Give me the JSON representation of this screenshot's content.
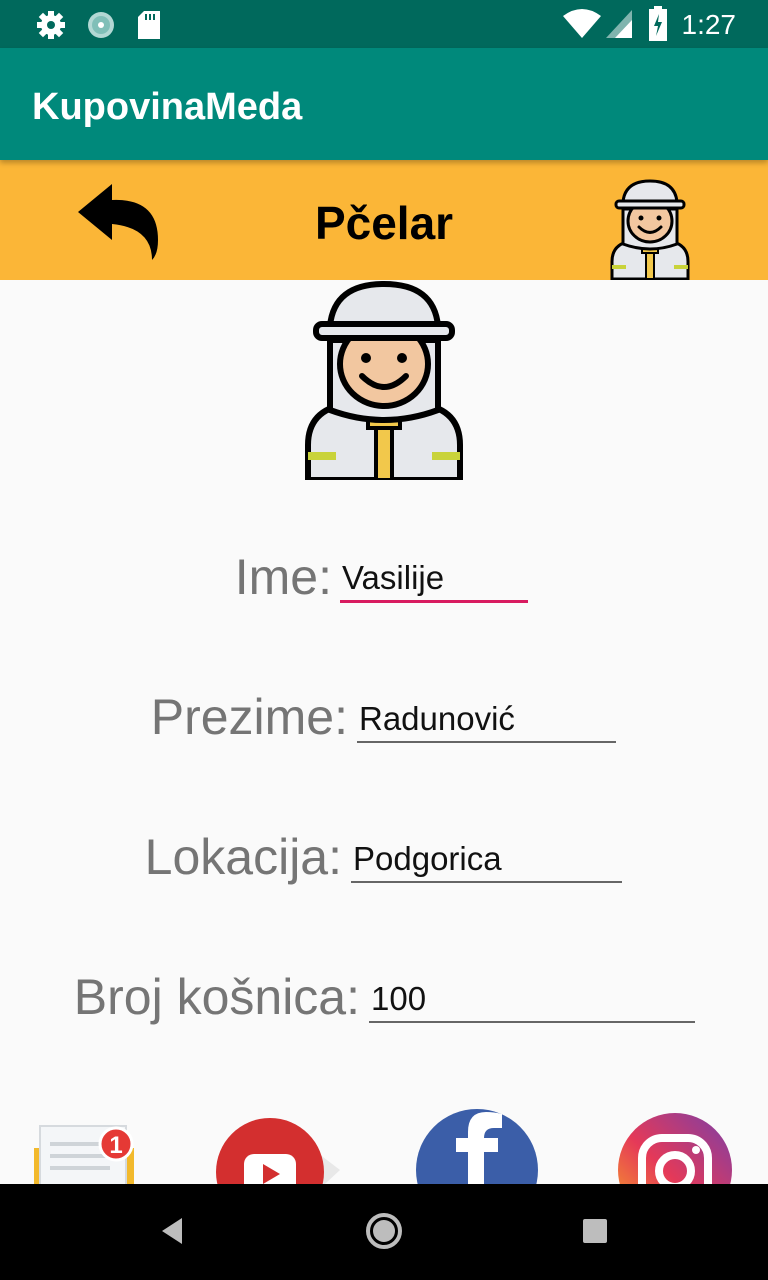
{
  "status_bar": {
    "time": "1:27",
    "left_icons": [
      "settings-icon",
      "sync-icon",
      "sd-card-icon"
    ],
    "right_icons": [
      "wifi-icon",
      "signal-icon",
      "battery-icon"
    ]
  },
  "app_bar": {
    "title": "KupovinaMeda"
  },
  "header": {
    "title": "Pčelar"
  },
  "form": {
    "ime_label": "Ime:",
    "ime_value": "Vasilije",
    "prezime_label": "Prezime:",
    "prezime_value": "Radunović",
    "lokacija_label": "Lokacija:",
    "lokacija_value": "Podgorica",
    "broj_label": "Broj košnica:",
    "broj_value": "100"
  },
  "social": {
    "mail_badge": "1",
    "icons": [
      "mail-icon",
      "youtube-icon",
      "facebook-icon",
      "instagram-icon"
    ]
  },
  "colors": {
    "status_bar": "#00695c",
    "app_bar": "#00897b",
    "header": "#fbb637",
    "active_field": "#d81b60"
  }
}
